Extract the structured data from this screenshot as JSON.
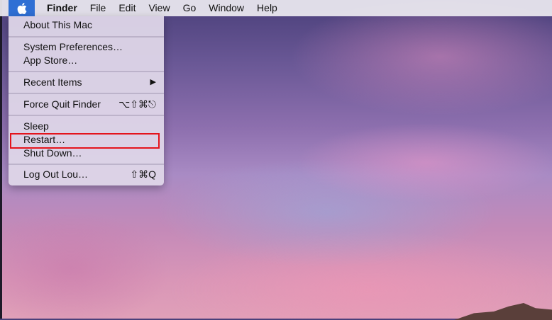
{
  "menubar": {
    "apple_icon": "apple-logo-icon",
    "items": [
      "Finder",
      "File",
      "Edit",
      "View",
      "Go",
      "Window",
      "Help"
    ]
  },
  "apple_menu": {
    "about": "About This Mac",
    "system_prefs": "System Preferences…",
    "app_store": "App Store…",
    "recent_items": "Recent Items",
    "submenu_arrow": "▶",
    "force_quit": "Force Quit Finder",
    "force_quit_shortcut": "⌥⇧⌘⎋",
    "sleep": "Sleep",
    "restart": "Restart…",
    "shut_down": "Shut Down…",
    "log_out": "Log Out Lou…",
    "log_out_shortcut": "⇧⌘Q"
  },
  "highlight_color": "#e4141c"
}
